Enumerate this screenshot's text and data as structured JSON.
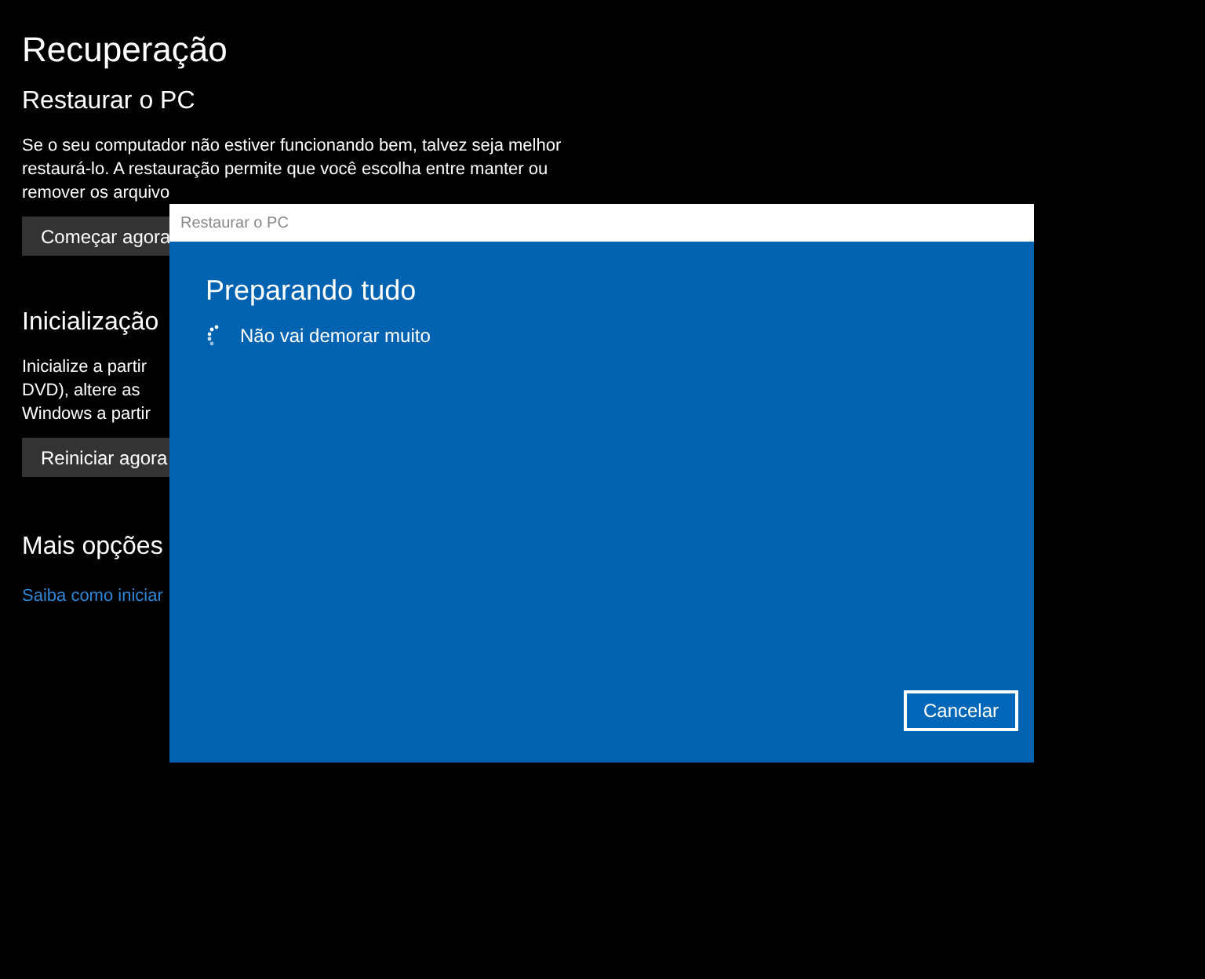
{
  "page": {
    "title": "Recuperação",
    "sections": [
      {
        "heading": "Restaurar o PC",
        "lines": [
          "Se o seu computador não estiver funcionando bem, talvez seja melhor",
          "restaurá-lo. A restauração permite que você escolha entre manter ou",
          "remover os arquivo"
        ],
        "button": "Começar agora"
      },
      {
        "heading": "Inicialização",
        "lines": [
          "Inicialize a partir",
          "DVD), altere as",
          "Windows a partir"
        ],
        "button": "Reiniciar agora"
      },
      {
        "heading": "Mais opções",
        "link": "Saiba como iniciar"
      }
    ]
  },
  "dialog": {
    "title": "Restaurar o PC",
    "heading": "Preparando tudo",
    "status": "Não vai demorar muito",
    "buttons": [
      "Cancelar"
    ]
  }
}
